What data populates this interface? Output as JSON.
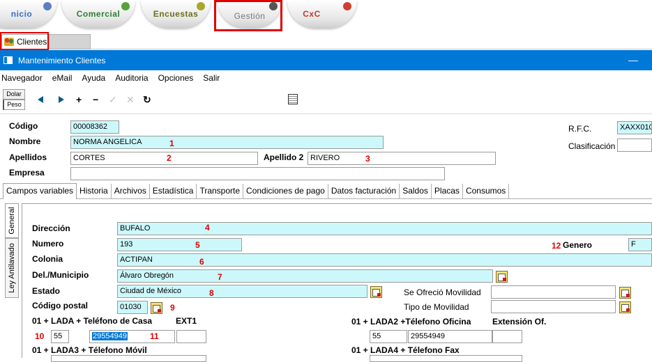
{
  "modules": [
    {
      "label": "nicio",
      "color": "#3a6bc7",
      "ball": "#5b7fc0"
    },
    {
      "label": "Comercial",
      "color": "#2f7d34",
      "ball": "#54a33a"
    },
    {
      "label": "Encuestas",
      "color": "#6b6f1a",
      "ball": "#a8a82a"
    },
    {
      "label": "Gestión",
      "color": "#777777",
      "ball": "#555555"
    },
    {
      "label": "CxC",
      "color": "#c0392b",
      "ball": "#d04030"
    }
  ],
  "doc_tab": {
    "label": "Clientes",
    "icon": "users-icon"
  },
  "window": {
    "title": "Mantenimiento Clientes",
    "minimize": "—"
  },
  "menu": [
    "Navegador",
    "eMail",
    "Ayuda",
    "Auditoria",
    "Opciones",
    "Salir"
  ],
  "currency": {
    "top": "Dolar",
    "bottom": "Peso"
  },
  "toolbar_icons": [
    "arrow-left-icon",
    "arrow-right-icon",
    "add-icon",
    "remove-icon",
    "check-icon",
    "cancel-icon",
    "refresh-icon",
    "document-icon"
  ],
  "toolbar_glyphs": {
    "add": "+",
    "remove": "−",
    "check": "✓",
    "cancel": "✕",
    "refresh": "↻"
  },
  "header": {
    "codigo_label": "Código",
    "codigo_value": "00008362",
    "nombre_label": "Nombre",
    "nombre_value": "NORMA ANGELICA",
    "apellidos_label": "Apellidos",
    "apellidos_value": "CORTES",
    "apellido2_label": "Apellido 2",
    "apellido2_value": "RIVERO",
    "empresa_label": "Empresa",
    "empresa_value": "",
    "rfc_label": "R.F.C.",
    "rfc_value": "XAXX010",
    "clasificacion_label": "Clasificación",
    "clasificacion_value": ""
  },
  "tabs": [
    "Campos variables",
    "Historia",
    "Archivos",
    "Estadística",
    "Transporte",
    "Condiciones de pago",
    "Datos facturación",
    "Saldos",
    "Placas",
    "Consumos"
  ],
  "side_tabs": [
    "General",
    "Ley Antilavado"
  ],
  "general": {
    "direccion_label": "Dirección",
    "direccion_value": "BUFALO",
    "numero_label": "Numero",
    "numero_value": "193",
    "genero_label": "Genero",
    "genero_value": "F",
    "colonia_label": "Colonia",
    "colonia_value": "ACTIPAN",
    "municipio_label": "Del./Municipio",
    "municipio_value": "Álvaro Obregón",
    "estado_label": "Estado",
    "estado_value": "Ciudad de México",
    "movilidad_label": "Se Ofreció Movilidad",
    "movilidad_value": "",
    "tipo_movilidad_label": "Tipo de Movilidad",
    "tipo_movilidad_value": "",
    "cp_label": "Código postal",
    "cp_value": "01030",
    "tel_casa_label": "01 + LADA  + Teléfono de Casa",
    "ext1_label": "EXT1",
    "lada_value": "55",
    "tel_casa_value": "29554949",
    "ext1_value": "",
    "tel_oficina_label": "01 + LADA2 +Télefono Oficina",
    "ext_of_label": "Extensión Of.",
    "lada2_value": "55",
    "tel_oficina_value": "29554949",
    "ext_of_value": "",
    "movil_label": "01 + LADA3 + Télefono Móvil",
    "fax_label": "01 + LADA4 + Télefono Fax"
  },
  "annotations": [
    "1",
    "2",
    "3",
    "4",
    "5",
    "6",
    "7",
    "8",
    "9",
    "10",
    "11",
    "12"
  ],
  "colors": {
    "accent": "#0078d7",
    "field_highlight": "#ccf8fb",
    "annotation": "#e00000"
  }
}
